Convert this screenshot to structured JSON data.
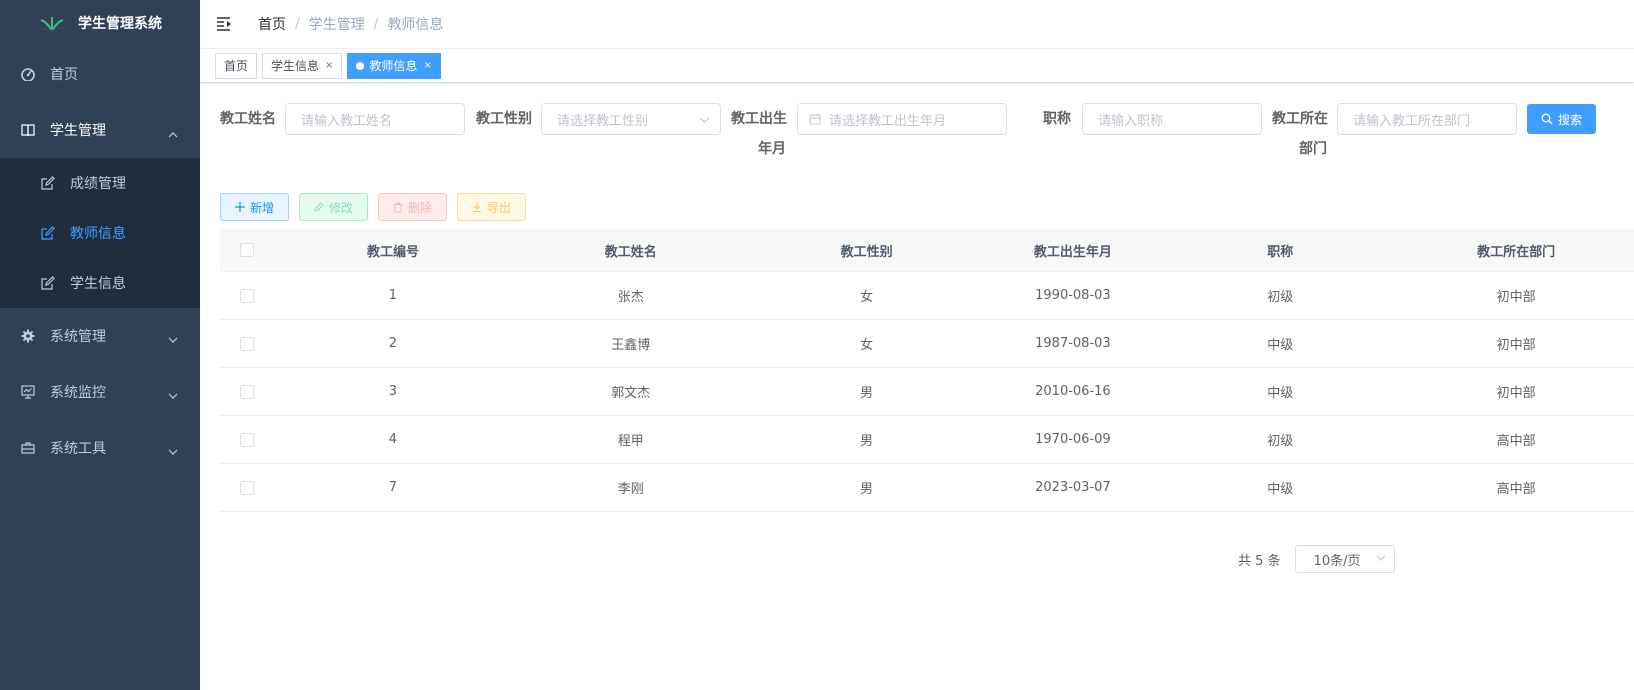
{
  "app": {
    "title": "学生管理系统"
  },
  "sidebar": {
    "items": [
      {
        "label": "首页",
        "icon": "dashboard-icon"
      },
      {
        "label": "学生管理",
        "icon": "book-icon",
        "expanded": true,
        "children": [
          {
            "label": "成绩管理",
            "icon": "edit-icon"
          },
          {
            "label": "教师信息",
            "icon": "edit-icon",
            "active": true
          },
          {
            "label": "学生信息",
            "icon": "edit-icon"
          }
        ]
      },
      {
        "label": "系统管理",
        "icon": "gear-icon"
      },
      {
        "label": "系统监控",
        "icon": "monitor-icon"
      },
      {
        "label": "系统工具",
        "icon": "toolbox-icon"
      }
    ]
  },
  "navbar": {
    "breadcrumb": [
      "首页",
      "学生管理",
      "教师信息"
    ],
    "sep": "/"
  },
  "tags": [
    {
      "label": "首页",
      "closable": false
    },
    {
      "label": "学生信息",
      "closable": true,
      "close": "×"
    },
    {
      "label": "教师信息",
      "closable": true,
      "active": true,
      "close": "×"
    }
  ],
  "search": {
    "name_label": "教工姓名",
    "name_placeholder": "请输入教工姓名",
    "gender_label": "教工性别",
    "gender_placeholder": "请选择教工性别",
    "birth_label_1": "教工出生",
    "birth_label_2": "年月",
    "birth_placeholder": "请选择教工出生年月",
    "title_label": "职称",
    "title_placeholder": "请输入职称",
    "dept_label_1": "教工所在",
    "dept_label_2": "部门",
    "dept_placeholder": "请输入教工所在部门",
    "search_button": "搜索"
  },
  "actions": {
    "add": "新增",
    "edit": "修改",
    "delete": "删除",
    "export": "导出"
  },
  "table": {
    "columns": [
      "教工编号",
      "教工姓名",
      "教工性别",
      "教工出生年月",
      "职称",
      "教工所在部门"
    ],
    "rows": [
      [
        "1",
        "张杰",
        "女",
        "1990-08-03",
        "初级",
        "初中部"
      ],
      [
        "2",
        "王鑫博",
        "女",
        "1987-08-03",
        "中级",
        "初中部"
      ],
      [
        "3",
        "郭文杰",
        "男",
        "2010-06-16",
        "中级",
        "初中部"
      ],
      [
        "4",
        "程甲",
        "男",
        "1970-06-09",
        "初级",
        "高中部"
      ],
      [
        "7",
        "李刚",
        "男",
        "2023-03-07",
        "中级",
        "高中部"
      ]
    ]
  },
  "pagination": {
    "total": "共 5 条",
    "page_size": "10条/页"
  },
  "colors": {
    "sidebar_bg": "#304156",
    "submenu_bg": "#1f2d3d",
    "primary": "#409eff",
    "logo_green": "#42b983"
  }
}
